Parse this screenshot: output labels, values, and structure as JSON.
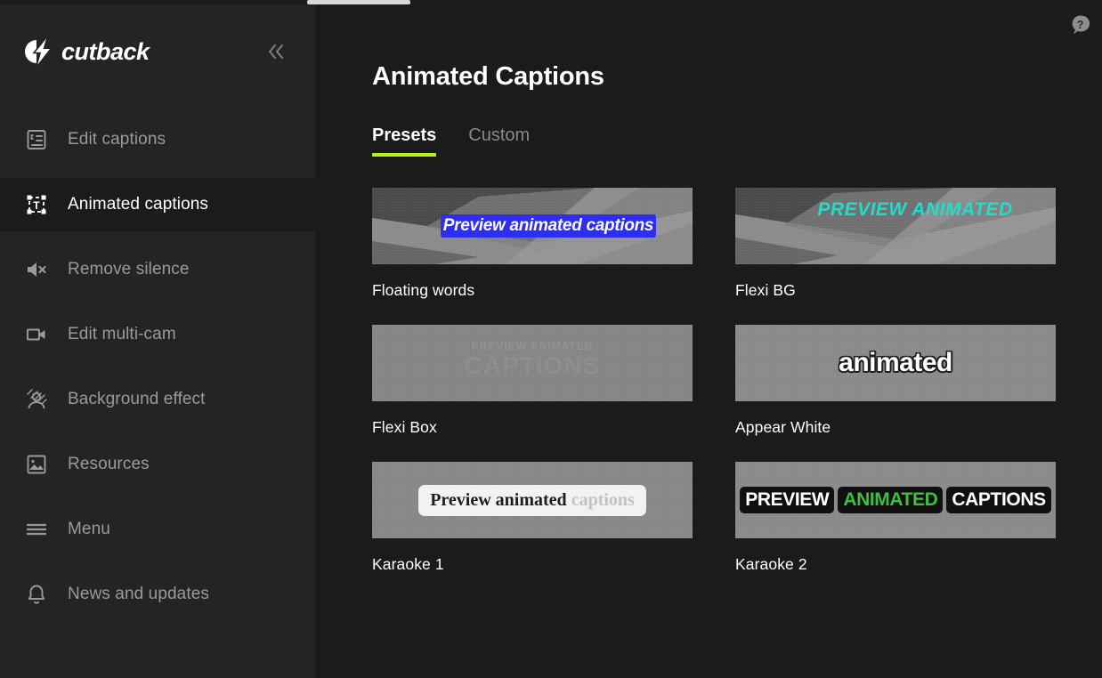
{
  "brand": {
    "name": "cutback",
    "logo_icon": "lightning-bolt-circle-icon"
  },
  "sidebar": {
    "collapse_icon": "chevron-double-left-icon",
    "items": [
      {
        "label": "Edit captions",
        "icon": "edit-captions-icon",
        "active": false
      },
      {
        "label": "Animated captions",
        "icon": "text-box-icon",
        "active": true
      },
      {
        "label": "Remove silence",
        "icon": "mute-speaker-icon",
        "active": false
      },
      {
        "label": "Edit multi-cam",
        "icon": "video-camera-icon",
        "active": false
      },
      {
        "label": "Background effect",
        "icon": "person-background-icon",
        "active": false
      },
      {
        "label": "Resources",
        "icon": "image-icon",
        "active": false
      },
      {
        "label": "Menu",
        "icon": "hamburger-menu-icon",
        "active": false
      },
      {
        "label": "News and updates",
        "icon": "bell-icon",
        "active": false
      }
    ]
  },
  "header": {
    "title": "Animated Captions",
    "help_icon": "question-mark-bubble-icon"
  },
  "tabs": [
    {
      "label": "Presets",
      "active": true
    },
    {
      "label": "Custom",
      "active": false
    }
  ],
  "accent_color": "#b4f318",
  "presets": [
    {
      "name": "Floating words",
      "preview_text": "Preview animated captions",
      "text_color": "#ffffff",
      "highlight_color": "#2e2ef0"
    },
    {
      "name": "Flexi BG",
      "preview_text": "PREVIEW ANIMATED",
      "text_color": "#22dcc8"
    },
    {
      "name": "Flexi Box",
      "preview_text_line1": "PREVIEW ANIMATED",
      "preview_text_line2": "CAPTIONS",
      "text_color": "#8c9698"
    },
    {
      "name": "Appear White",
      "preview_text": "animated",
      "text_color": "#ffffff"
    },
    {
      "name": "Karaoke 1",
      "preview_text_sung": "Preview animated",
      "preview_text_unsung": " captions",
      "sung_color": "#1d1d1d",
      "unsung_color": "#c2c2c2"
    },
    {
      "name": "Karaoke 2",
      "preview_word1": "PREVIEW",
      "preview_word2": "ANIMATED",
      "preview_word3": "CAPTIONS",
      "highlight_color": "#3fbf3f"
    }
  ]
}
